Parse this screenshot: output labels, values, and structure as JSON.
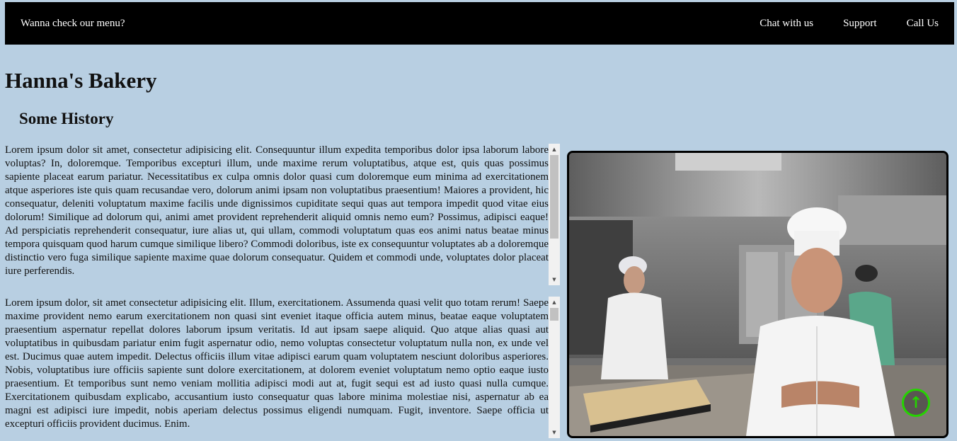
{
  "nav": {
    "menu_link": "Wanna check our menu?",
    "links": [
      "Chat with us",
      "Support",
      "Call Us"
    ]
  },
  "page": {
    "title": "Hanna's Bakery",
    "section_title": "Some History"
  },
  "paragraphs": [
    "Lorem ipsum dolor sit amet, consectetur adipisicing elit. Consequuntur illum expedita temporibus dolor ipsa laborum labore voluptas? In, doloremque. Temporibus excepturi illum, unde maxime rerum voluptatibus, atque est, quis quas possimus sapiente placeat earum pariatur. Necessitatibus ex culpa omnis dolor quasi cum doloremque eum minima ad exercitationem atque asperiores iste quis quam recusandae vero, dolorum animi ipsam non voluptatibus praesentium! Maiores a provident, hic consequatur, deleniti voluptatum maxime facilis unde dignissimos cupiditate sequi quas aut tempora impedit quod vitae eius dolorum! Similique ad dolorum qui, animi amet provident reprehenderit aliquid omnis nemo eum? Possimus, adipisci eaque! Ad perspiciatis reprehenderit consequatur, iure alias ut, qui ullam, commodi voluptatum quas eos animi natus beatae minus tempora quisquam quod harum cumque similique libero? Commodi doloribus, iste ex consequuntur voluptates ab a doloremque distinctio vero fuga similique sapiente maxime quae dolorum consequatur. Quidem et commodi unde, voluptates dolor placeat iure perferendis.",
    "Lorem ipsum dolor, sit amet consectetur adipisicing elit. Illum, exercitationem. Assumenda quasi velit quo totam rerum! Saepe maxime provident nemo earum exercitationem non quasi sint eveniet itaque officia autem minus, beatae eaque voluptatem praesentium aspernatur repellat dolores laborum ipsum veritatis. Id aut ipsam saepe aliquid. Quo atque alias quasi aut voluptatibus in quibusdam pariatur enim fugit aspernatur odio, nemo voluptas consectetur voluptatum nulla non, ex unde vel est. Ducimus quae autem impedit. Delectus officiis illum vitae adipisci earum quam voluptatem nesciunt doloribus asperiores. Nobis, voluptatibus iure officiis sapiente sunt dolore exercitationem, at dolorem eveniet voluptatum nemo optio eaque iusto praesentium. Et temporibus sunt nemo veniam mollitia adipisci modi aut at, fugit sequi est ad iusto quasi nulla cumque. Exercitationem quibusdam explicabo, accusantium iusto consequatur quas labore minima molestiae nisi, aspernatur ab ea magni est adipisci iure impedit, nobis aperiam delectus possimus eligendi numquam. Fugit, inventore. Saepe officia ut excepturi officiis provident ducimus. Enim."
  ],
  "colors": {
    "background": "#b8cfe2",
    "navbar": "#000000",
    "back_to_top": "#25d400"
  },
  "icons": {
    "back_to_top": "arrow-up-circle-icon"
  }
}
